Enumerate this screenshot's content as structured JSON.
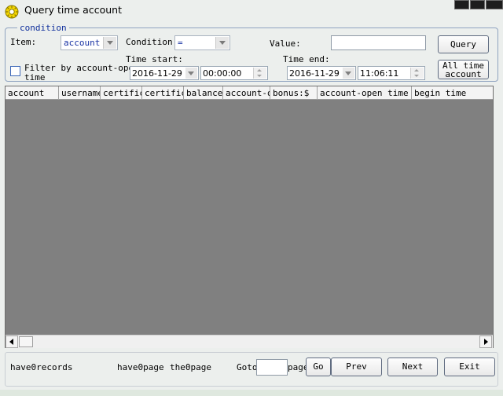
{
  "window": {
    "title": "Query time account",
    "controls": [
      "minimize",
      "maximize",
      "close"
    ]
  },
  "condition": {
    "legend": "condition",
    "item_label": "Item:",
    "item_value": "account",
    "condition_label": "Condition:",
    "condition_value": "=",
    "value_label": "Value:",
    "value_input": "",
    "query_button": "Query",
    "filter_label_line1": "Filter by account-ope",
    "filter_label_line2": "time",
    "filter_checked": false,
    "time_start_label": "Time start:",
    "time_start_date": "2016-11-29",
    "time_start_time": "00:00:00",
    "time_end_label": "Time end:",
    "time_end_date": "2016-11-29",
    "time_end_time": "11:06:11",
    "all_time_button_line1": "All time",
    "all_time_button_line2": "account"
  },
  "grid": {
    "columns": [
      "account",
      "username",
      "certific",
      "certific",
      "balance",
      "account-o",
      "bonus:$",
      "account-open time",
      "begin time"
    ],
    "rows": []
  },
  "footer": {
    "records": "have0records",
    "pages": "have0page",
    "current": "the0page",
    "goto_label": "Goto",
    "goto_value": "",
    "page_label": "page",
    "go_button": "Go",
    "prev_button": "Prev",
    "next_button": "Next",
    "exit_button": "Exit"
  },
  "colors": {
    "grid_background": "#808080",
    "legend_text": "#0f2f9c",
    "combo_text": "#1631a3"
  }
}
